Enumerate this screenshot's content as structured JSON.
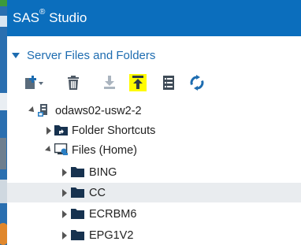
{
  "app": {
    "title": "SAS",
    "title_sup": "®",
    "title_rest": " Studio"
  },
  "panel": {
    "title": "Server Files and Folders"
  },
  "toolbar": {
    "icons": [
      "new-item-dropdown-icon",
      "delete-icon",
      "download-icon",
      "upload-icon",
      "properties-icon",
      "refresh-icon"
    ]
  },
  "tree": {
    "server": "odaws02-usw2-2",
    "folder_shortcuts": "Folder Shortcuts",
    "files_home": "Files (Home)",
    "folders": [
      "BING",
      "CC",
      "ECRBM6",
      "EPG1V2"
    ],
    "selected": "CC"
  },
  "colors": {
    "title_bar": "#0b6ebd",
    "accent": "#1d6cb0",
    "highlight": "#fffb00",
    "selected_row": "#e9ecef"
  }
}
